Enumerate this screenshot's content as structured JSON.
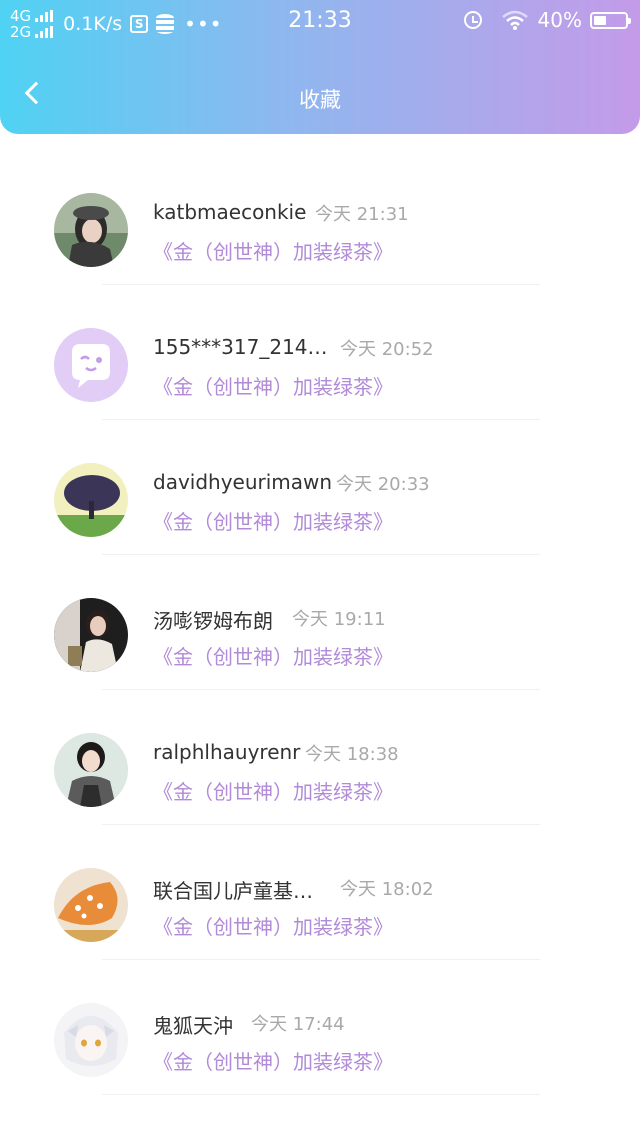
{
  "status_bar": {
    "net_top": "4G",
    "net_bottom": "2G",
    "speed": "0.1K/s",
    "s_icon_text": "S",
    "more": "•••",
    "time": "21:33",
    "battery_percent": "40%",
    "battery_level": 0.4
  },
  "header": {
    "title": "收藏"
  },
  "colors": {
    "header_gradient_start": "#4fd2f3",
    "header_gradient_end": "#c49be9",
    "book_title": "#b18ad8",
    "time_text": "#a9a9a9"
  },
  "favorites": [
    {
      "name": "katbmaeconkie",
      "time": "今天 21:31",
      "book": "《金（创世神）加装绿茶》",
      "avatar": "avatar-woman-cap"
    },
    {
      "name": "155***317_214…",
      "time": "今天 20:52",
      "book": "《金（创世神）加装绿茶》",
      "avatar": "avatar-default-wink"
    },
    {
      "name": "davidhyeurimawn",
      "time": "今天 20:33",
      "book": "《金（创世神）加装绿茶》",
      "avatar": "avatar-tree"
    },
    {
      "name": "汤嘭锣姆布朗",
      "time": "今天 19:11",
      "book": "《金（创世神）加装绿茶》",
      "avatar": "avatar-girl-dark"
    },
    {
      "name": "ralphlhauyrenr",
      "time": "今天 18:38",
      "book": "《金（创世神）加装绿茶》",
      "avatar": "avatar-boy-hoodie"
    },
    {
      "name": "联合国儿庐童基…",
      "time": "今天 18:02",
      "book": "《金（创世神）加装绿茶》",
      "avatar": "avatar-orange-shell"
    },
    {
      "name": "鬼狐天沖",
      "time": "今天 17:44",
      "book": "《金（创世神）加装绿茶》",
      "avatar": "avatar-anime-white"
    }
  ]
}
